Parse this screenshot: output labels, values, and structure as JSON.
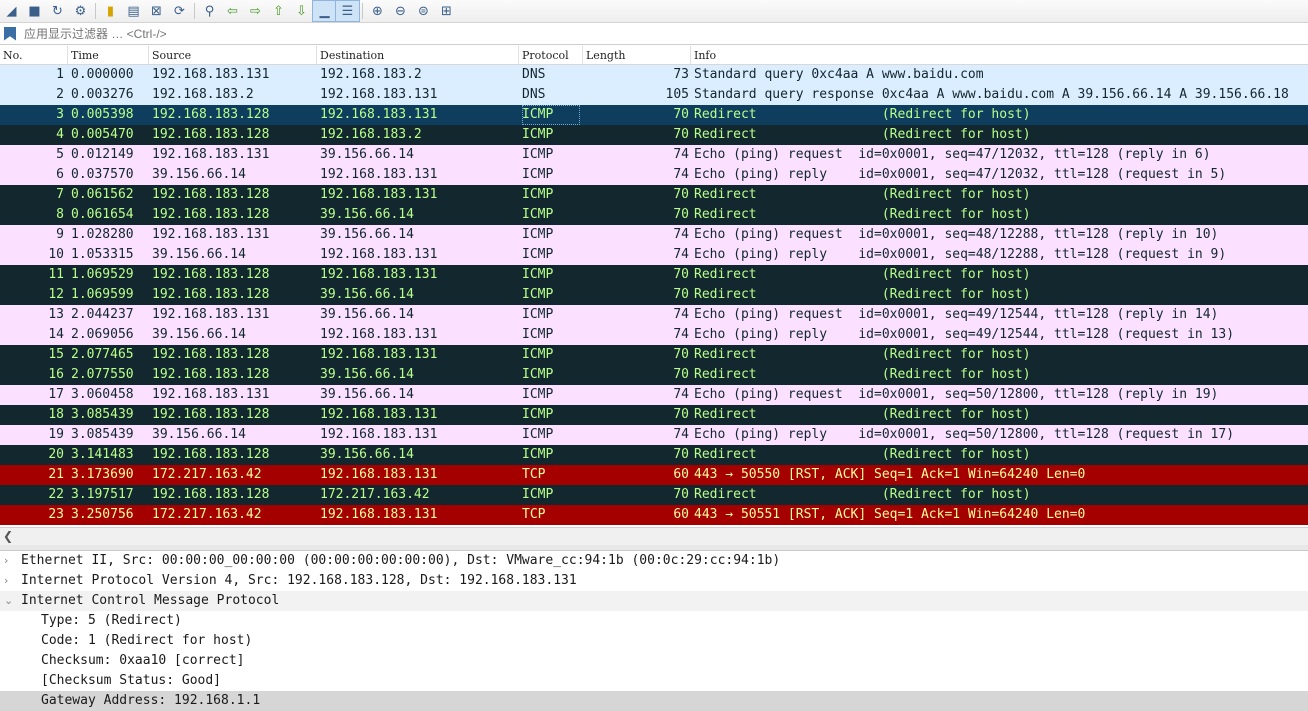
{
  "toolbar": {
    "icons": [
      "wireshark-fin-icon",
      "stop-icon",
      "restart-icon",
      "options-gear-icon",
      "open-file-icon",
      "save-file-icon",
      "close-file-icon",
      "reload-icon",
      "find-packet-icon",
      "go-back-icon",
      "go-forward-icon",
      "go-to-first-icon",
      "go-to-last-icon",
      "autoscroll-icon",
      "colorize-icon",
      "zoom-in-icon",
      "zoom-out-icon",
      "normal-size-icon",
      "resize-columns-icon"
    ]
  },
  "filter": {
    "placeholder": "应用显示过滤器 … <Ctrl-/>"
  },
  "columns": {
    "no": "No.",
    "time": "Time",
    "source": "Source",
    "destination": "Destination",
    "protocol": "Protocol",
    "length": "Length",
    "info": "Info"
  },
  "packets": [
    {
      "no": "1",
      "time": "0.000000",
      "src": "192.168.183.131",
      "dst": "192.168.183.2",
      "proto": "DNS",
      "len": "73",
      "info": "Standard query 0xc4aa A www.baidu.com",
      "style": "dns"
    },
    {
      "no": "2",
      "time": "0.003276",
      "src": "192.168.183.2",
      "dst": "192.168.183.131",
      "proto": "DNS",
      "len": "105",
      "info": "Standard query response 0xc4aa A www.baidu.com A 39.156.66.14 A 39.156.66.18",
      "style": "dns"
    },
    {
      "no": "3",
      "time": "0.005398",
      "src": "192.168.183.128",
      "dst": "192.168.183.131",
      "proto": "ICMP",
      "len": "70",
      "info": "Redirect                (Redirect for host)",
      "style": "selected"
    },
    {
      "no": "4",
      "time": "0.005470",
      "src": "192.168.183.128",
      "dst": "192.168.183.2",
      "proto": "ICMP",
      "len": "70",
      "info": "Redirect                (Redirect for host)",
      "style": "bad green"
    },
    {
      "no": "5",
      "time": "0.012149",
      "src": "192.168.183.131",
      "dst": "39.156.66.14",
      "proto": "ICMP",
      "len": "74",
      "info": "Echo (ping) request  id=0x0001, seq=47/12032, ttl=128 (reply in 6)",
      "style": "icmp"
    },
    {
      "no": "6",
      "time": "0.037570",
      "src": "39.156.66.14",
      "dst": "192.168.183.131",
      "proto": "ICMP",
      "len": "74",
      "info": "Echo (ping) reply    id=0x0001, seq=47/12032, ttl=128 (request in 5)",
      "style": "icmp"
    },
    {
      "no": "7",
      "time": "0.061562",
      "src": "192.168.183.128",
      "dst": "192.168.183.131",
      "proto": "ICMP",
      "len": "70",
      "info": "Redirect                (Redirect for host)",
      "style": "bad green"
    },
    {
      "no": "8",
      "time": "0.061654",
      "src": "192.168.183.128",
      "dst": "39.156.66.14",
      "proto": "ICMP",
      "len": "70",
      "info": "Redirect                (Redirect for host)",
      "style": "bad green"
    },
    {
      "no": "9",
      "time": "1.028280",
      "src": "192.168.183.131",
      "dst": "39.156.66.14",
      "proto": "ICMP",
      "len": "74",
      "info": "Echo (ping) request  id=0x0001, seq=48/12288, ttl=128 (reply in 10)",
      "style": "icmp"
    },
    {
      "no": "10",
      "time": "1.053315",
      "src": "39.156.66.14",
      "dst": "192.168.183.131",
      "proto": "ICMP",
      "len": "74",
      "info": "Echo (ping) reply    id=0x0001, seq=48/12288, ttl=128 (request in 9)",
      "style": "icmp"
    },
    {
      "no": "11",
      "time": "1.069529",
      "src": "192.168.183.128",
      "dst": "192.168.183.131",
      "proto": "ICMP",
      "len": "70",
      "info": "Redirect                (Redirect for host)",
      "style": "bad green"
    },
    {
      "no": "12",
      "time": "1.069599",
      "src": "192.168.183.128",
      "dst": "39.156.66.14",
      "proto": "ICMP",
      "len": "70",
      "info": "Redirect                (Redirect for host)",
      "style": "bad green"
    },
    {
      "no": "13",
      "time": "2.044237",
      "src": "192.168.183.131",
      "dst": "39.156.66.14",
      "proto": "ICMP",
      "len": "74",
      "info": "Echo (ping) request  id=0x0001, seq=49/12544, ttl=128 (reply in 14)",
      "style": "icmp"
    },
    {
      "no": "14",
      "time": "2.069056",
      "src": "39.156.66.14",
      "dst": "192.168.183.131",
      "proto": "ICMP",
      "len": "74",
      "info": "Echo (ping) reply    id=0x0001, seq=49/12544, ttl=128 (request in 13)",
      "style": "icmp"
    },
    {
      "no": "15",
      "time": "2.077465",
      "src": "192.168.183.128",
      "dst": "192.168.183.131",
      "proto": "ICMP",
      "len": "70",
      "info": "Redirect                (Redirect for host)",
      "style": "bad green"
    },
    {
      "no": "16",
      "time": "2.077550",
      "src": "192.168.183.128",
      "dst": "39.156.66.14",
      "proto": "ICMP",
      "len": "70",
      "info": "Redirect                (Redirect for host)",
      "style": "bad green"
    },
    {
      "no": "17",
      "time": "3.060458",
      "src": "192.168.183.131",
      "dst": "39.156.66.14",
      "proto": "ICMP",
      "len": "74",
      "info": "Echo (ping) request  id=0x0001, seq=50/12800, ttl=128 (reply in 19)",
      "style": "icmp"
    },
    {
      "no": "18",
      "time": "3.085439",
      "src": "192.168.183.128",
      "dst": "192.168.183.131",
      "proto": "ICMP",
      "len": "70",
      "info": "Redirect                (Redirect for host)",
      "style": "bad green"
    },
    {
      "no": "19",
      "time": "3.085439",
      "src": "39.156.66.14",
      "dst": "192.168.183.131",
      "proto": "ICMP",
      "len": "74",
      "info": "Echo (ping) reply    id=0x0001, seq=50/12800, ttl=128 (request in 17)",
      "style": "icmp"
    },
    {
      "no": "20",
      "time": "3.141483",
      "src": "192.168.183.128",
      "dst": "39.156.66.14",
      "proto": "ICMP",
      "len": "70",
      "info": "Redirect                (Redirect for host)",
      "style": "bad green"
    },
    {
      "no": "21",
      "time": "3.173690",
      "src": "172.217.163.42",
      "dst": "192.168.183.131",
      "proto": "TCP",
      "len": "60",
      "info": "443 → 50550 [RST, ACK] Seq=1 Ack=1 Win=64240 Len=0",
      "style": "tcperr"
    },
    {
      "no": "22",
      "time": "3.197517",
      "src": "192.168.183.128",
      "dst": "172.217.163.42",
      "proto": "ICMP",
      "len": "70",
      "info": "Redirect                (Redirect for host)",
      "style": "bad green"
    },
    {
      "no": "23",
      "time": "3.250756",
      "src": "172.217.163.42",
      "dst": "192.168.183.131",
      "proto": "TCP",
      "len": "60",
      "info": "443 → 50551 [RST, ACK] Seq=1 Ack=1 Win=64240 Len=0",
      "style": "tcperr"
    }
  ],
  "details": [
    {
      "text": "Ethernet II, Src: 00:00:00_00:00:00 (00:00:00:00:00:00), Dst: VMware_cc:94:1b (00:0c:29:cc:94:1b)",
      "level": 0,
      "toggle": "collapsed"
    },
    {
      "text": "Internet Protocol Version 4, Src: 192.168.183.128, Dst: 192.168.183.131",
      "level": 0,
      "toggle": "collapsed"
    },
    {
      "text": "Internet Control Message Protocol",
      "level": 0,
      "toggle": "expanded"
    },
    {
      "text": "Type: 5 (Redirect)",
      "level": 1,
      "toggle": "none"
    },
    {
      "text": "Code: 1 (Redirect for host)",
      "level": 1,
      "toggle": "none"
    },
    {
      "text": "Checksum: 0xaa10 [correct]",
      "level": 1,
      "toggle": "none"
    },
    {
      "text": "[Checksum Status: Good]",
      "level": 1,
      "toggle": "none"
    },
    {
      "text": "Gateway Address: 192.168.1.1",
      "level": 1,
      "toggle": "none",
      "selected": true
    }
  ]
}
